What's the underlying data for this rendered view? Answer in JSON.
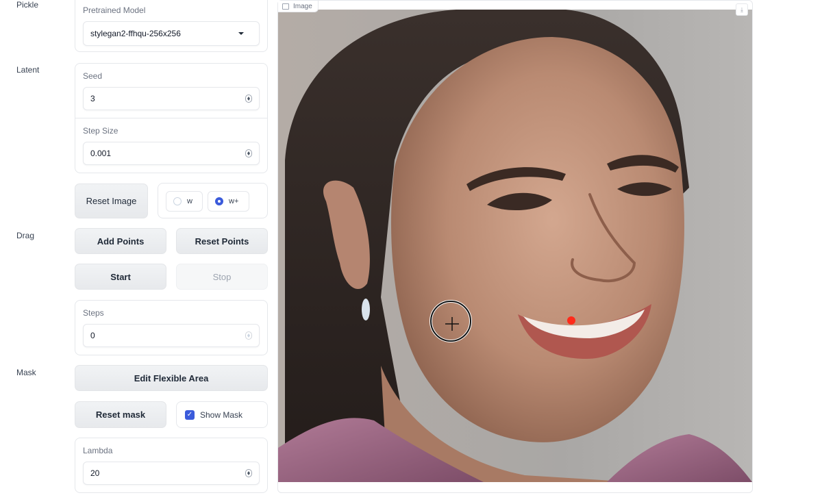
{
  "sections": {
    "pickle": "Pickle",
    "latent": "Latent",
    "drag": "Drag",
    "mask": "Mask"
  },
  "pickle": {
    "model_label": "Pretrained Model",
    "model_value": "stylegan2-ffhqu-256x256"
  },
  "latent": {
    "seed_label": "Seed",
    "seed_value": "3",
    "step_size_label": "Step Size",
    "step_size_value": "0.001",
    "reset_image": "Reset Image",
    "space_options": [
      {
        "label": "w",
        "selected": false
      },
      {
        "label": "w+",
        "selected": true
      }
    ]
  },
  "drag": {
    "add_points": "Add Points",
    "reset_points": "Reset Points",
    "start": "Start",
    "stop": "Stop",
    "steps_label": "Steps",
    "steps_value": "0"
  },
  "mask": {
    "edit_flexible_area": "Edit Flexible Area",
    "reset_mask": "Reset mask",
    "show_mask_label": "Show Mask",
    "show_mask_checked": true,
    "lambda_label": "Lambda",
    "lambda_value": "20"
  },
  "image_panel": {
    "label": "Image",
    "download_icon": "download-icon",
    "cursor_icon": "crosshair-cursor-icon",
    "handle_point_color": "#ff2a1a"
  },
  "colors": {
    "accent": "#3b5bdb",
    "button_bg": "#eceef1"
  }
}
